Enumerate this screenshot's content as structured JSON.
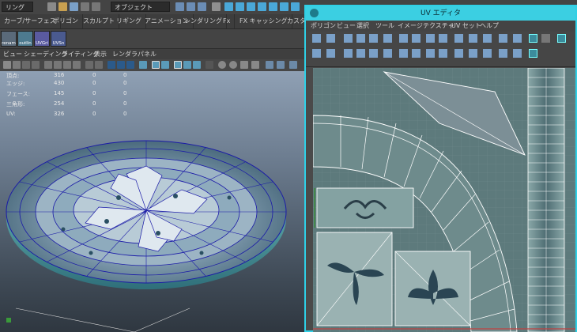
{
  "status_line": {
    "mode_menu": "リング",
    "selection_mask": "オブジェクト"
  },
  "shelf_tabs": [
    "カーブ/サーフェス",
    "ポリゴン",
    "スカルプト",
    "リギング",
    "アニメーション",
    "レンダリング",
    "Fx",
    "FX キャッシング",
    "カスタ"
  ],
  "shelf_buttons": [
    "renam",
    "outlin",
    "UVGri",
    "UVSn"
  ],
  "panel_menu": [
    "ビュー",
    "シェーディング",
    "ライティング",
    "表示",
    "レンダラ",
    "パネル"
  ],
  "hud": {
    "rows": [
      {
        "label": "頂点:",
        "a": "316",
        "b": "0",
        "c": "0"
      },
      {
        "label": "エッジ:",
        "a": "430",
        "b": "0",
        "c": "0"
      },
      {
        "label": "フェース:",
        "a": "145",
        "b": "0",
        "c": "0"
      },
      {
        "label": "三角形:",
        "a": "254",
        "b": "0",
        "c": "0"
      },
      {
        "label": "UV:",
        "a": "326",
        "b": "0",
        "c": "0"
      }
    ]
  },
  "uv_editor": {
    "title": "UV エディタ",
    "menu": [
      "ポリゴン",
      "ビュー",
      "選択",
      "ツール",
      "イメージ",
      "テクスチャ",
      "UV セット",
      "ヘルプ"
    ]
  },
  "colors": {
    "uv_title_bar": "#3bcfe2",
    "wireframe": "#1a1aa8",
    "uv_shell_outline": "#ffffff",
    "uv_background": "#5d7a7c"
  }
}
